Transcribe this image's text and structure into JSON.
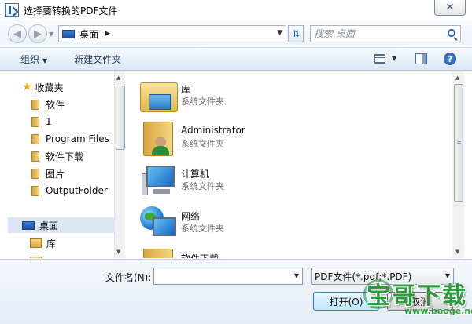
{
  "window": {
    "title": "选择要转换的PDF文件",
    "close_glyph": "✕"
  },
  "navbar": {
    "back_glyph": "◀",
    "forward_glyph": "▶",
    "breadcrumb": "桌面",
    "crumb_arrow": "▶",
    "refresh_glyph": "⇅",
    "search_placeholder": "搜索 桌面"
  },
  "toolbar": {
    "organize_label": "组织",
    "new_folder_label": "新建文件夹",
    "help_glyph": "?"
  },
  "navpane": {
    "favorites_label": "收藏夹",
    "items": [
      {
        "label": "软件"
      },
      {
        "label": "1"
      },
      {
        "label": "Program Files"
      },
      {
        "label": "软件下载"
      },
      {
        "label": "图片"
      },
      {
        "label": "OutputFolder"
      }
    ],
    "desktop_label": "桌面",
    "library_label": "库"
  },
  "files": [
    {
      "name": "库",
      "desc": "系统文件夹",
      "icon": "library-icon"
    },
    {
      "name": "Administrator",
      "desc": "系统文件夹",
      "icon": "user-folder-icon"
    },
    {
      "name": "计算机",
      "desc": "系统文件夹",
      "icon": "computer-icon"
    },
    {
      "name": "网络",
      "desc": "系统文件夹",
      "icon": "network-icon"
    },
    {
      "name": "软件下载",
      "desc": "",
      "icon": "folder-icon"
    }
  ],
  "bottom": {
    "filename_label": "文件名(N):",
    "filename_value": "",
    "filetype_value": "PDF文件(*.pdf;*.PDF)",
    "open_label": "打开(O)",
    "cancel_label": "取消"
  },
  "watermark": {
    "text": "宝哥下载",
    "url": "www.baoge.net"
  }
}
